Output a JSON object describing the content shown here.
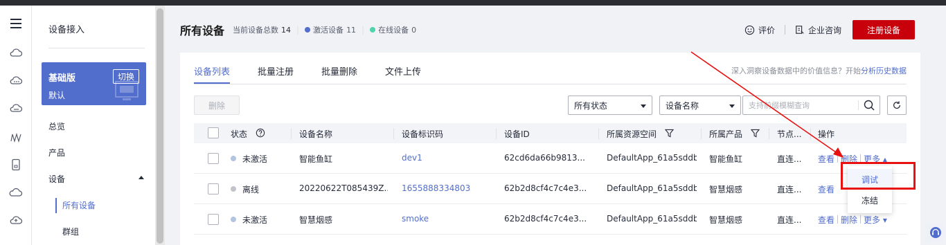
{
  "sidebar": {
    "title": "设备接入",
    "plan": {
      "name": "基础版",
      "default_label": "默认",
      "switch_label": "切换"
    },
    "nav": {
      "overview": "总览",
      "product": "产品",
      "device": "设备"
    },
    "subnav": {
      "all_devices": "所有设备",
      "groups": "群组"
    }
  },
  "iconbar": [
    "menu-icon",
    "cloud-icon",
    "cloud-dots-icon",
    "cloud-alt-icon",
    "wave-icon",
    "device-icon",
    "cloud-outline-icon",
    "cloud-upload-icon"
  ],
  "header": {
    "title": "所有设备",
    "total_label": "当前设备总数",
    "total_value": "14",
    "active_label": "激活设备",
    "active_value": "11",
    "online_label": "在线设备",
    "online_value": "0",
    "rate_label": "评价",
    "consult_label": "企业咨询",
    "register_button": "注册设备"
  },
  "colors": {
    "active_dot": "#526ecc",
    "online_dot": "#50d4ab",
    "primary": "#c7000b",
    "accent": "#526ecc",
    "highlight": "#e8110f"
  },
  "tabs": [
    "设备列表",
    "批量注册",
    "批量删除",
    "文件上传"
  ],
  "insight": {
    "text": "深入洞察设备数据中的价值信息？开始",
    "link": "分析历史数据"
  },
  "toolbar": {
    "delete_button": "删除",
    "status_filter": "所有状态",
    "field_filter": "设备名称",
    "search_placeholder": "支持前缀模糊查询"
  },
  "table": {
    "headers": [
      "状态",
      "设备名称",
      "设备标识码",
      "设备ID",
      "所属资源空间",
      "所属产品",
      "节点...",
      "操作"
    ],
    "rows": [
      {
        "status": "未激活",
        "status_color": "#b3c4e0",
        "name": "智能鱼缸",
        "identifier": "dev1",
        "device_id": "62cd6da66b9813...",
        "space": "DefaultApp_61a5sddb",
        "product": "智能鱼缸",
        "node": "直连...",
        "view": "查看",
        "delete": "删除",
        "more": "更多"
      },
      {
        "status": "离线",
        "status_color": "#c2c4cc",
        "name": "20220622T085439Z...",
        "identifier": "1655888334803",
        "device_id": "62b2d8cf4c7c4e3...",
        "space": "DefaultApp_61a5sddb",
        "product": "智慧烟感",
        "node": "直连...",
        "view": "查看",
        "delete": "删除",
        "more": "更多"
      },
      {
        "status": "未激活",
        "status_color": "#b3c4e0",
        "name": "智慧烟感",
        "identifier": "smoke",
        "device_id": "62b2d8cf4c7c4e3...",
        "space": "DefaultApp_61a5sddb",
        "product": "智慧烟感",
        "node": "直连...",
        "view": "查看",
        "delete": "删除",
        "more": "更多"
      }
    ]
  },
  "dropdown": {
    "items": [
      "调试",
      "冻结"
    ]
  }
}
